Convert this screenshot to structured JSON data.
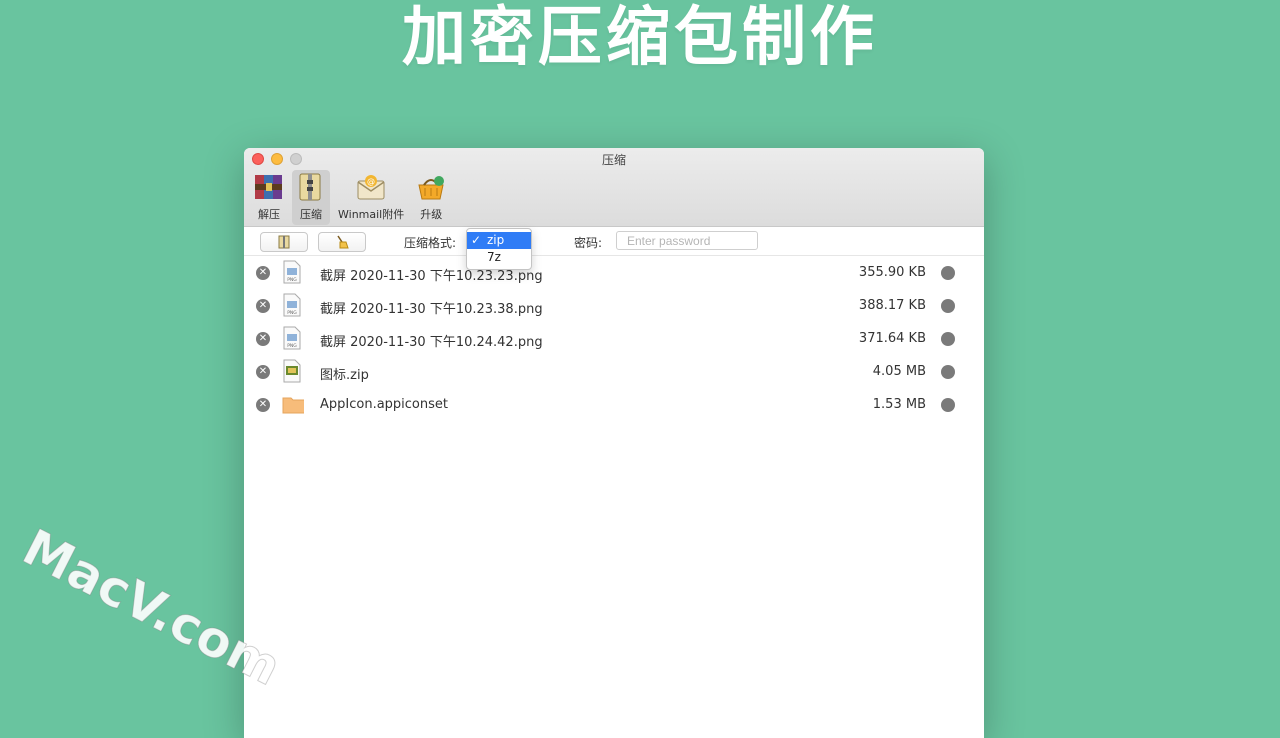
{
  "headline": "加密压缩包制作",
  "watermark": "MacV.com",
  "window": {
    "title": "压缩",
    "toolbar": [
      {
        "label": "解压",
        "icon": "archive-books-icon"
      },
      {
        "label": "压缩",
        "icon": "compress-zipper-icon"
      },
      {
        "label": "Winmail附件",
        "icon": "mail-envelope-icon"
      },
      {
        "label": "升级",
        "icon": "basket-icon"
      }
    ],
    "options": {
      "format_label": "压缩格式:",
      "password_label": "密码:",
      "password_placeholder": "Enter password",
      "format_options": [
        {
          "label": "zip",
          "checkmark": "✓"
        },
        {
          "label": "7z"
        }
      ]
    },
    "files": [
      {
        "name": "截屏 2020-11-30 下午10.23.23.png",
        "size": "355.90 KB",
        "icon": "png-file-icon"
      },
      {
        "name": "截屏 2020-11-30 下午10.23.38.png",
        "size": "388.17 KB",
        "icon": "png-file-icon"
      },
      {
        "name": "截屏 2020-11-30 下午10.24.42.png",
        "size": "371.64 KB",
        "icon": "png-file-icon"
      },
      {
        "name": "图标.zip",
        "size": "4.05 MB",
        "icon": "zip-file-icon"
      },
      {
        "name": "AppIcon.appiconset",
        "size": "1.53 MB",
        "icon": "folder-icon"
      }
    ]
  },
  "colors": {
    "background": "#69c49f",
    "selection": "#2f7cf6",
    "close": "#fc605c",
    "minimize": "#fdbc40"
  }
}
